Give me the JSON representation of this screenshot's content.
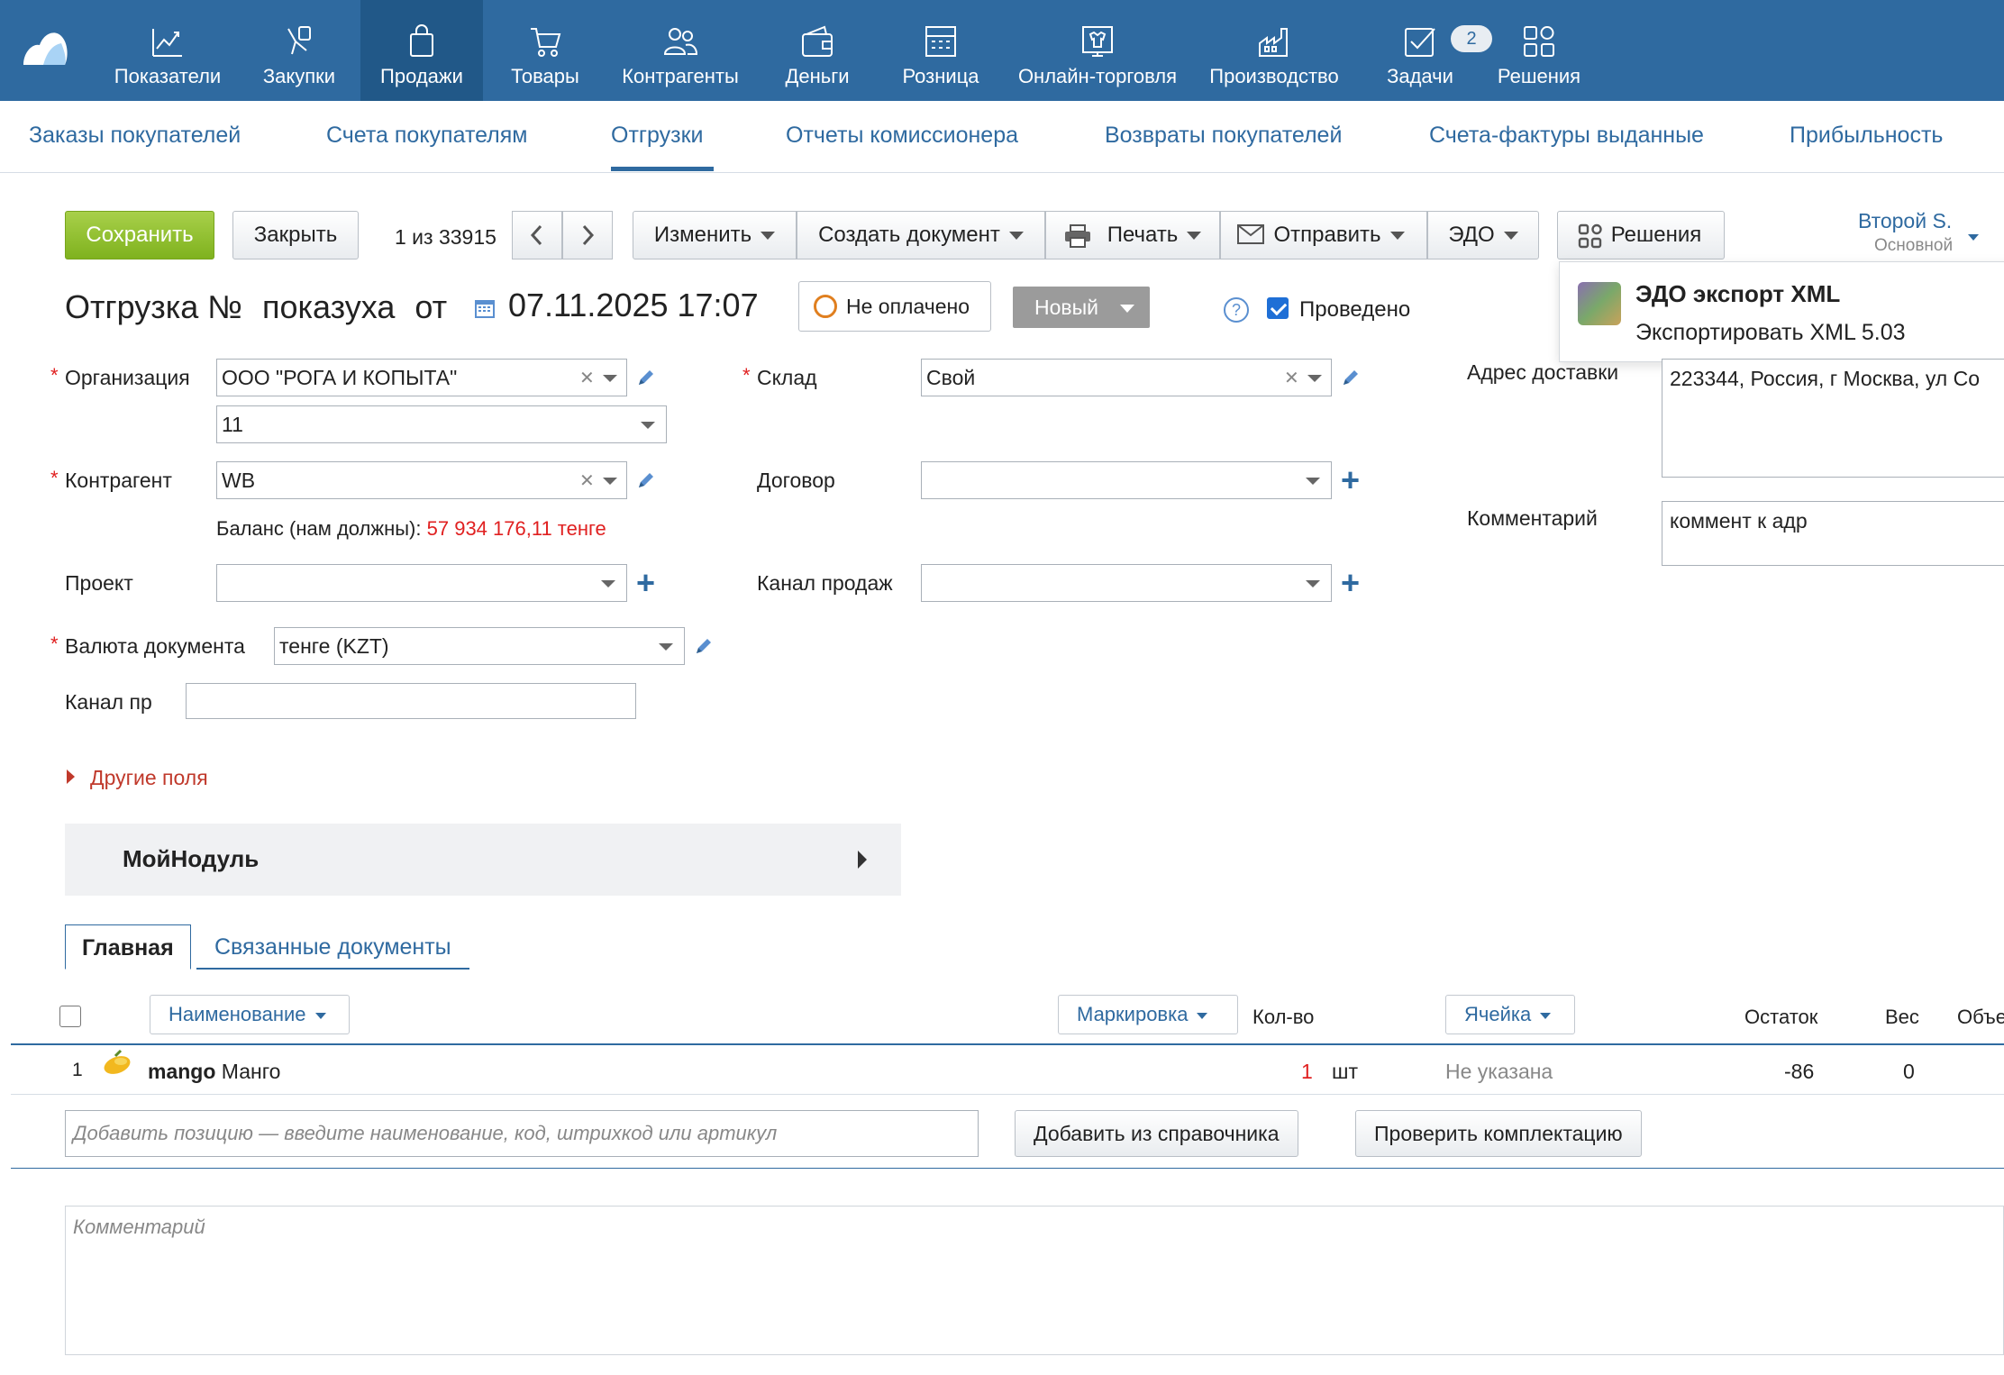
{
  "nav": {
    "items": [
      {
        "label": "Показатели",
        "icon": "chart-line-icon"
      },
      {
        "label": "Закупки",
        "icon": "hand-bag-icon"
      },
      {
        "label": "Продажи",
        "icon": "shopping-bag-icon"
      },
      {
        "label": "Товары",
        "icon": "cart-icon"
      },
      {
        "label": "Контрагенты",
        "icon": "people-icon"
      },
      {
        "label": "Деньги",
        "icon": "wallet-icon"
      },
      {
        "label": "Розница",
        "icon": "cash-register-icon"
      },
      {
        "label": "Онлайн-торговля",
        "icon": "online-shop-icon"
      },
      {
        "label": "Производство",
        "icon": "factory-icon"
      },
      {
        "label": "Задачи",
        "icon": "tasks-icon"
      },
      {
        "label": "Решения",
        "icon": "apps-grid-icon"
      }
    ],
    "active_index": 2,
    "tasks_badge": "2"
  },
  "subnav": {
    "items": [
      "Заказы покупателей",
      "Счета покупателям",
      "Отгрузки",
      "Отчеты комиссионера",
      "Возвраты покупателей",
      "Счета-фактуры выданные",
      "Прибыльность"
    ],
    "active_index": 2
  },
  "toolbar": {
    "save": "Сохранить",
    "close": "Закрыть",
    "counter": "1 из 33915",
    "edit": "Изменить",
    "create_doc": "Создать документ",
    "print": "Печать",
    "send": "Отправить",
    "edo": "ЭДО",
    "solutions": "Решения"
  },
  "user": {
    "name": "Второй S.",
    "role": "Основной"
  },
  "popover": {
    "title": "ЭДО экспорт XML",
    "subtitle": "Экспортировать XML 5.03"
  },
  "document": {
    "title_prefix": "Отгрузка №",
    "number": "показуха",
    "from": "от",
    "date": "07.11.2025 17:07",
    "payment_status": "Не оплачено",
    "status": "Новый",
    "help": "?",
    "posted_label": "Проведено",
    "posted": true
  },
  "form": {
    "organization_label": "Организация",
    "organization_value": "ООО \"РОГА И КОПЫТА\"",
    "organization_account": "11",
    "warehouse_label": "Склад",
    "warehouse_value": "Свой",
    "counterparty_label": "Контрагент",
    "counterparty_value": "WB",
    "contract_label": "Договор",
    "contract_value": "",
    "balance_label": "Баланс (нам должны):",
    "balance_value": "57 934 176,11 тенге",
    "project_label": "Проект",
    "project_value": "",
    "sales_channel_label": "Канал продаж",
    "sales_channel_value": "",
    "currency_label": "Валюта документа",
    "currency_value": "тенге (KZT)",
    "channel_pr_label": "Канал пр",
    "channel_pr_value": "",
    "delivery_address_label": "Адрес доставки",
    "delivery_address_value": "223344, Россия, г Москва, ул Со",
    "comment_label": "Комментарий",
    "comment_value": "коммент к адр",
    "other_fields": "Другие поля",
    "module_title": "МойНодуль"
  },
  "tabs": {
    "main": "Главная",
    "linked": "Связанные документы"
  },
  "table": {
    "headers": {
      "name": "Наименование",
      "marking": "Маркировка",
      "qty": "Кол-во",
      "cell": "Ячейка",
      "stock": "Остаток",
      "weight": "Вес",
      "volume": "Объе"
    },
    "rows": [
      {
        "num": "1",
        "code": "mango",
        "name": "Манго",
        "qty": "1",
        "unit": "шт",
        "cell": "Не указана",
        "stock": "-86",
        "weight": "0"
      }
    ],
    "add_placeholder": "Добавить позицию — введите наименование, код, штрихкод или артикул",
    "add_from_catalog": "Добавить из справочника",
    "check_kit": "Проверить комплектацию"
  },
  "comment_placeholder": "Комментарий"
}
